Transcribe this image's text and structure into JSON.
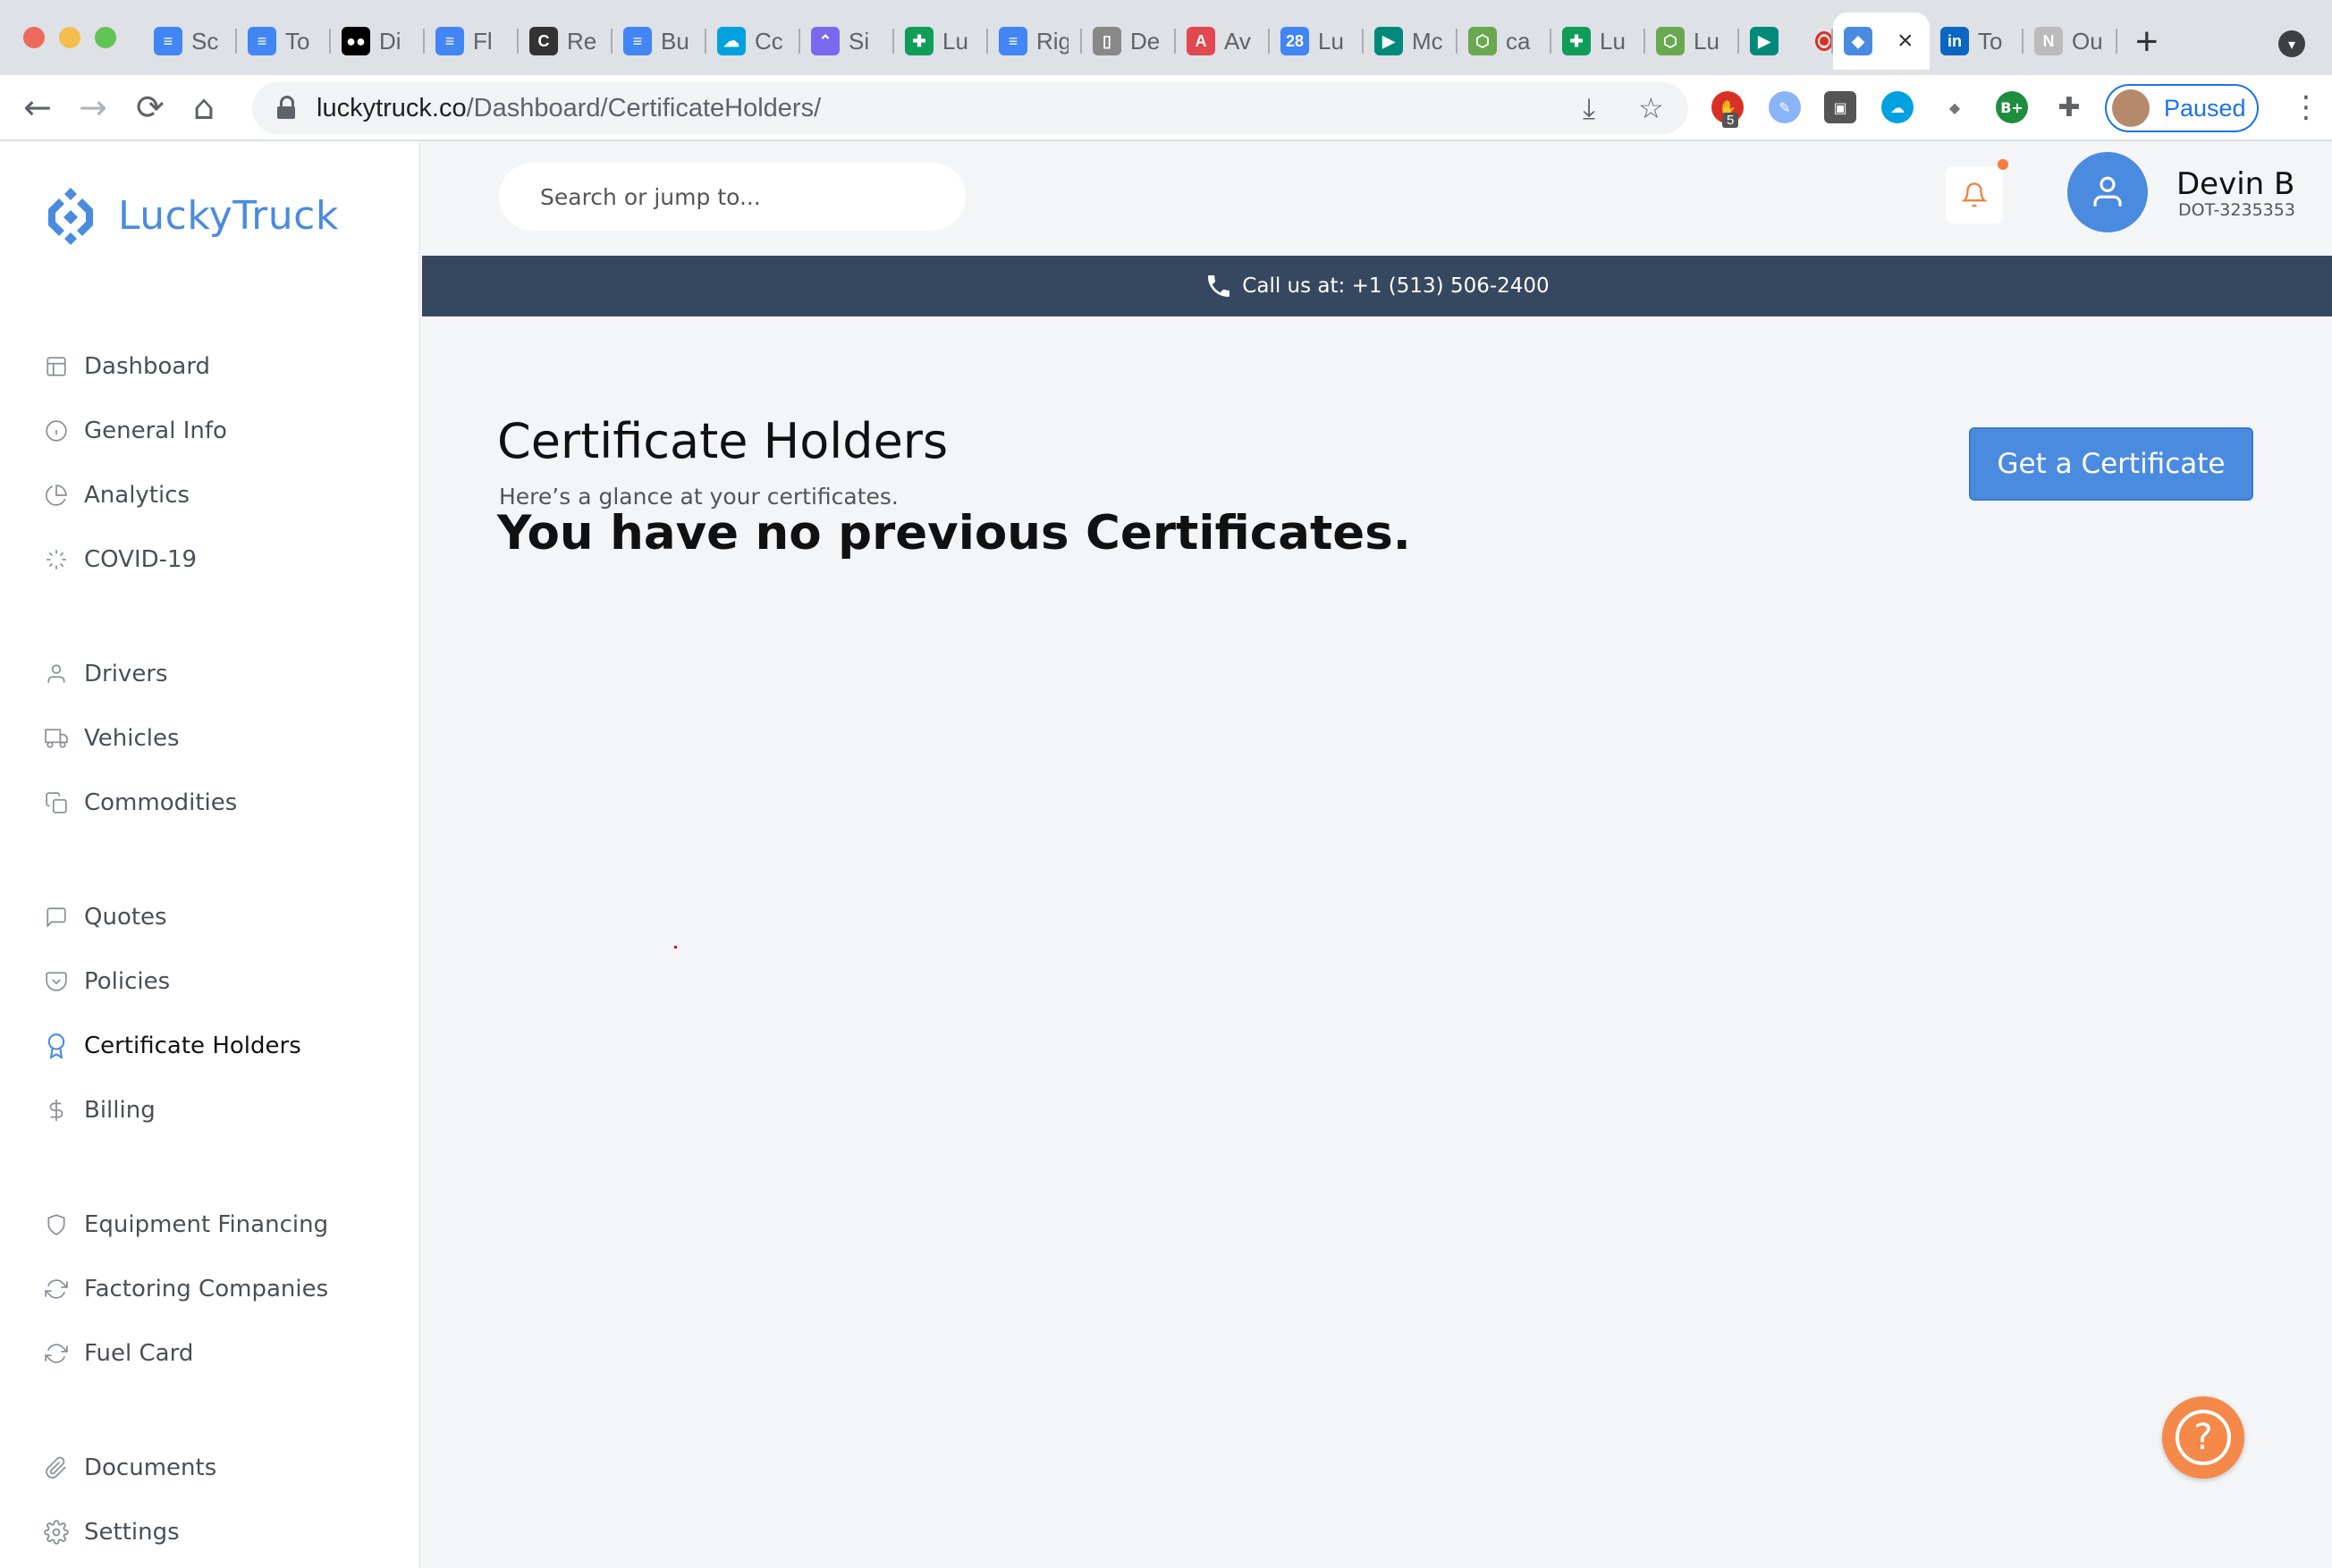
{
  "browser": {
    "tabs": [
      {
        "title": "Sc",
        "favicon": "google-docs-icon",
        "color": "#4285f4"
      },
      {
        "title": "To",
        "favicon": "google-docs-icon",
        "color": "#4285f4"
      },
      {
        "title": "Di",
        "favicon": "medium-icon",
        "color": "#000000"
      },
      {
        "title": "Fl",
        "favicon": "google-docs-icon",
        "color": "#4285f4"
      },
      {
        "title": "Re",
        "favicon": "colorado-icon",
        "color": "#333333"
      },
      {
        "title": "Bu",
        "favicon": "google-docs-icon",
        "color": "#4285f4"
      },
      {
        "title": "Cc",
        "favicon": "salesforce-icon",
        "color": "#00a1e0"
      },
      {
        "title": "Si",
        "favicon": "clickup-icon",
        "color": "#7b68ee"
      },
      {
        "title": "Lu",
        "favicon": "google-sheets-icon",
        "color": "#0f9d58"
      },
      {
        "title": "Rig",
        "favicon": "google-docs-icon",
        "color": "#4285f4"
      },
      {
        "title": "De",
        "favicon": "notepad-icon",
        "color": "#888888"
      },
      {
        "title": "Av",
        "favicon": "acrobat-icon",
        "color": "#e34850"
      },
      {
        "title": "Lu",
        "favicon": "calendar-icon",
        "color": "#4285f4"
      },
      {
        "title": "Mc",
        "favicon": "meet-icon",
        "color": "#00897b"
      },
      {
        "title": "ca",
        "favicon": "green-hex-icon",
        "color": "#6aa84f"
      },
      {
        "title": "Lu",
        "favicon": "google-sheets-icon",
        "color": "#0f9d58"
      },
      {
        "title": "Lu",
        "favicon": "green-hex-icon",
        "color": "#6aa84f"
      },
      {
        "title": "",
        "favicon": "meet-recording-icon",
        "color": "#00897b"
      },
      {
        "title": "",
        "favicon": "luckytruck-icon",
        "color": "#4a8be0",
        "active": true
      },
      {
        "title": "To",
        "favicon": "linkedin-icon",
        "color": "#0a66c2"
      },
      {
        "title": "Ou",
        "favicon": "notion-icon",
        "color": "#bbbbbb"
      }
    ],
    "url_host": "luckytruck.co",
    "url_path": "/Dashboard/CertificateHolders/",
    "extension_badge": "5",
    "profile_label": "Paused"
  },
  "brand": {
    "name": "LuckyTruck",
    "color": "#4a8be0"
  },
  "search": {
    "placeholder": "Search or jump to..."
  },
  "user": {
    "name": "Devin B",
    "dot": "DOT-3235353"
  },
  "callbar": {
    "text": "Call us at: +1 (513) 506-2400",
    "color": "#364860"
  },
  "sidebar": {
    "items": [
      {
        "label": "Dashboard",
        "icon": "layout-icon"
      },
      {
        "label": "General Info",
        "icon": "info-icon"
      },
      {
        "label": "Analytics",
        "icon": "pie-chart-icon"
      },
      {
        "label": "COVID-19",
        "icon": "loader-icon"
      },
      {
        "label": "Drivers",
        "icon": "user-icon"
      },
      {
        "label": "Vehicles",
        "icon": "truck-icon"
      },
      {
        "label": "Commodities",
        "icon": "copy-icon"
      },
      {
        "label": "Quotes",
        "icon": "message-square-icon"
      },
      {
        "label": "Policies",
        "icon": "pocket-icon"
      },
      {
        "label": "Certificate Holders",
        "icon": "award-icon",
        "active": true
      },
      {
        "label": "Billing",
        "icon": "dollar-icon"
      },
      {
        "label": "Equipment Financing",
        "icon": "shield-icon"
      },
      {
        "label": "Factoring Companies",
        "icon": "refresh-icon"
      },
      {
        "label": "Fuel Card",
        "icon": "refresh-icon"
      },
      {
        "label": "Documents",
        "icon": "paperclip-icon"
      },
      {
        "label": "Settings",
        "icon": "gear-icon"
      }
    ]
  },
  "main": {
    "title": "Certificate Holders",
    "subtitle": "Here’s a glance at your certificates.",
    "empty_message": "You have no previous Certificates.",
    "cta_label": "Get a Certificate",
    "accent": "#4a8be0"
  },
  "help": {
    "symbol": "?",
    "color": "#f4894a"
  }
}
